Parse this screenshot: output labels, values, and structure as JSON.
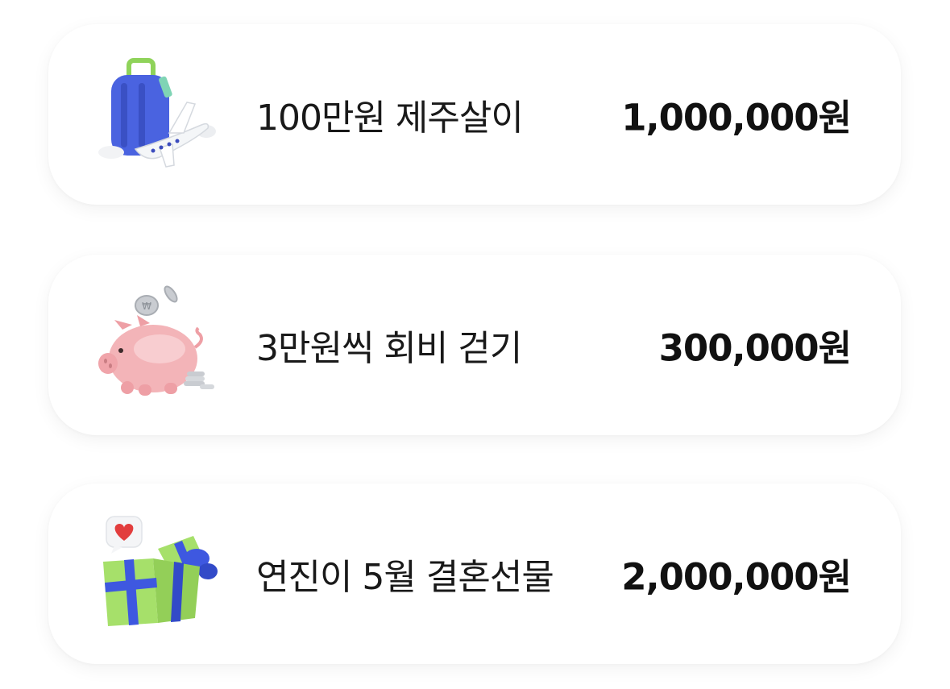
{
  "goals": [
    {
      "icon": "travel-luggage-airplane-icon",
      "label": "100만원 제주살이",
      "amount": "1,000,000원"
    },
    {
      "icon": "piggy-bank-coins-icon",
      "label": "3만원씩 회비 걷기",
      "amount": "300,000원"
    },
    {
      "icon": "gift-box-heart-icon",
      "label": "연진이 5월 결혼선물",
      "amount": "2,000,000원"
    }
  ],
  "colors": {
    "card_background": "#ffffff",
    "text": "#191919",
    "luggage_blue": "#4a63e0",
    "luggage_handle": "#8fd35a",
    "piggy_pink": "#f3b4b8",
    "gift_green": "#a6e06a",
    "gift_ribbon": "#3e58e0",
    "heart_red": "#e23d3d"
  }
}
